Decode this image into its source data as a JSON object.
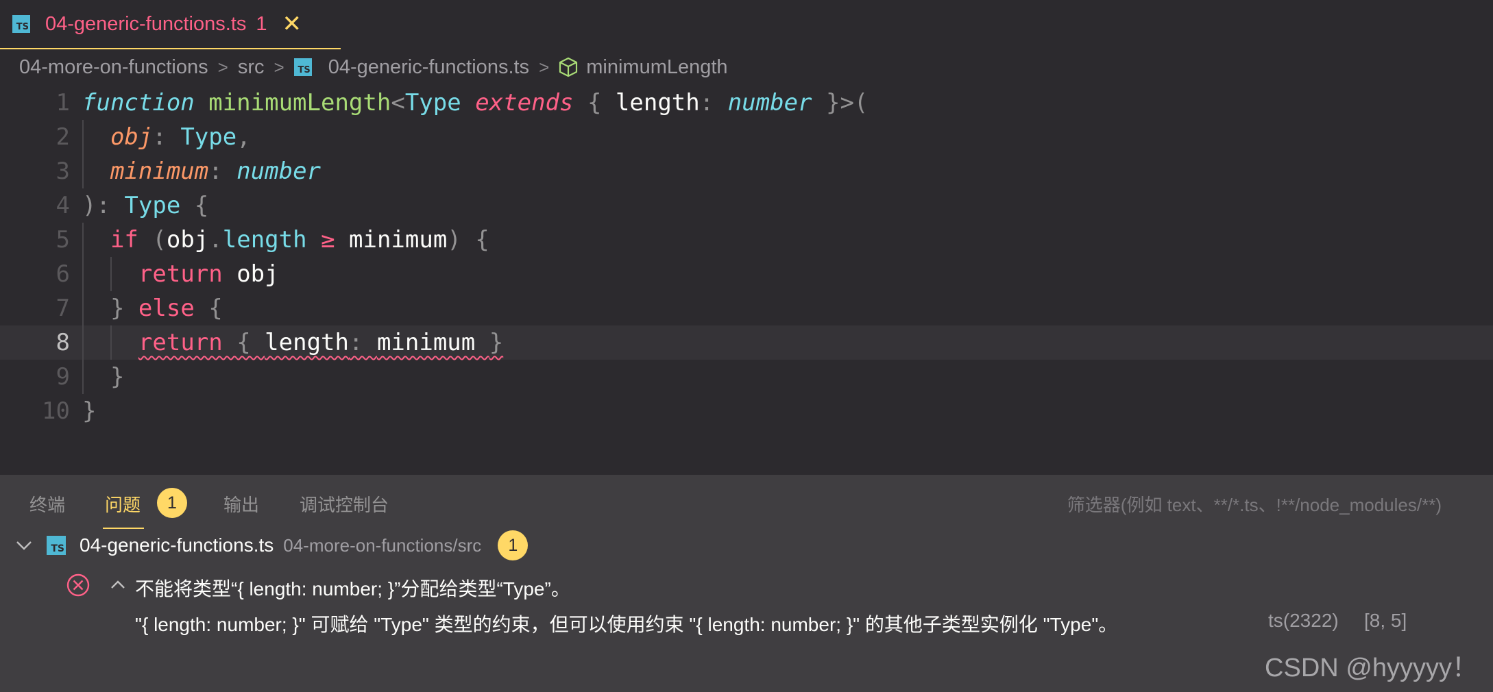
{
  "tab": {
    "icon": "typescript-file-icon",
    "icon_text": "TS",
    "title": "04-generic-functions.ts",
    "problem_count": "1"
  },
  "breadcrumb": {
    "items": [
      "04-more-on-functions",
      "src",
      "04-generic-functions.ts",
      "minimumLength"
    ],
    "file_icon_text": "TS"
  },
  "editor": {
    "current_line": 8,
    "line_numbers": [
      "1",
      "2",
      "3",
      "4",
      "5",
      "6",
      "7",
      "8",
      "9",
      "10"
    ],
    "lines": [
      {
        "tokens": [
          [
            "function ",
            "fn-kw"
          ],
          [
            "minimumLength",
            "fname"
          ],
          [
            "<",
            "punc"
          ],
          [
            "Type ",
            "ty"
          ],
          [
            "extends",
            "ext"
          ],
          [
            " { ",
            "punc"
          ],
          [
            "length",
            "plain"
          ],
          [
            ": ",
            "punc"
          ],
          [
            "number",
            "ity"
          ],
          [
            " }>(",
            "punc"
          ]
        ]
      },
      {
        "tokens": [
          [
            "obj",
            "param"
          ],
          [
            ": ",
            "punc"
          ],
          [
            "Type",
            "ty"
          ],
          [
            ",",
            "punc"
          ]
        ]
      },
      {
        "tokens": [
          [
            "minimum",
            "param"
          ],
          [
            ": ",
            "punc"
          ],
          [
            "number",
            "ity"
          ]
        ]
      },
      {
        "tokens": [
          [
            "): ",
            "punc"
          ],
          [
            "Type ",
            "ty"
          ],
          [
            "{",
            "punc"
          ]
        ]
      },
      {
        "tokens": [
          [
            "if ",
            "kw"
          ],
          [
            "(",
            "punc"
          ],
          [
            "obj",
            "plain"
          ],
          [
            ".",
            "punc"
          ],
          [
            "length",
            "ty"
          ],
          [
            " ≥ ",
            "kw"
          ],
          [
            "minimum",
            "plain"
          ],
          [
            ") {",
            "punc"
          ]
        ]
      },
      {
        "tokens": [
          [
            "return ",
            "kw"
          ],
          [
            "obj",
            "plain"
          ]
        ]
      },
      {
        "tokens": [
          [
            "} ",
            "punc"
          ],
          [
            "else ",
            "kw"
          ],
          [
            "{",
            "punc"
          ]
        ]
      },
      {
        "tokens": [
          [
            "return ",
            "kw"
          ],
          [
            "{ ",
            "punc"
          ],
          [
            "length",
            "plain"
          ],
          [
            ": ",
            "punc"
          ],
          [
            "minimum ",
            "plain"
          ],
          [
            "}",
            "punc"
          ]
        ]
      },
      {
        "tokens": [
          [
            "}",
            "punc"
          ]
        ]
      },
      {
        "tokens": [
          [
            "}",
            "punc"
          ]
        ]
      }
    ]
  },
  "panel": {
    "tabs": [
      "终端",
      "问题",
      "输出",
      "调试控制台"
    ],
    "active_tab": "问题",
    "problems_badge": "1",
    "filter_placeholder": "筛选器(例如 text、**/*.ts、!**/node_modules/**)",
    "file": {
      "icon_text": "TS",
      "name": "04-generic-functions.ts",
      "path": "04-more-on-functions/src",
      "count": "1"
    },
    "problem": {
      "message_line1": "不能将类型“{ length: number; }”分配给类型“Type”。",
      "message_line2": "\"{ length: number; }\" 可赋给 \"Type\" 类型的约束，但可以使用约束 \"{ length: number; }\" 的其他子类型实例化 \"Type\"。",
      "code": "ts(2322)",
      "position": "[8, 5]"
    }
  },
  "watermark": "CSDN @hyyyyy！",
  "colors": {
    "background": "#2c2a2e",
    "panel": "#403e41",
    "accent_yellow": "#ffd866",
    "keyword_pink": "#ff6188",
    "type_cyan": "#78dce8",
    "function_green": "#a9dc76",
    "param_orange": "#fc9867"
  }
}
